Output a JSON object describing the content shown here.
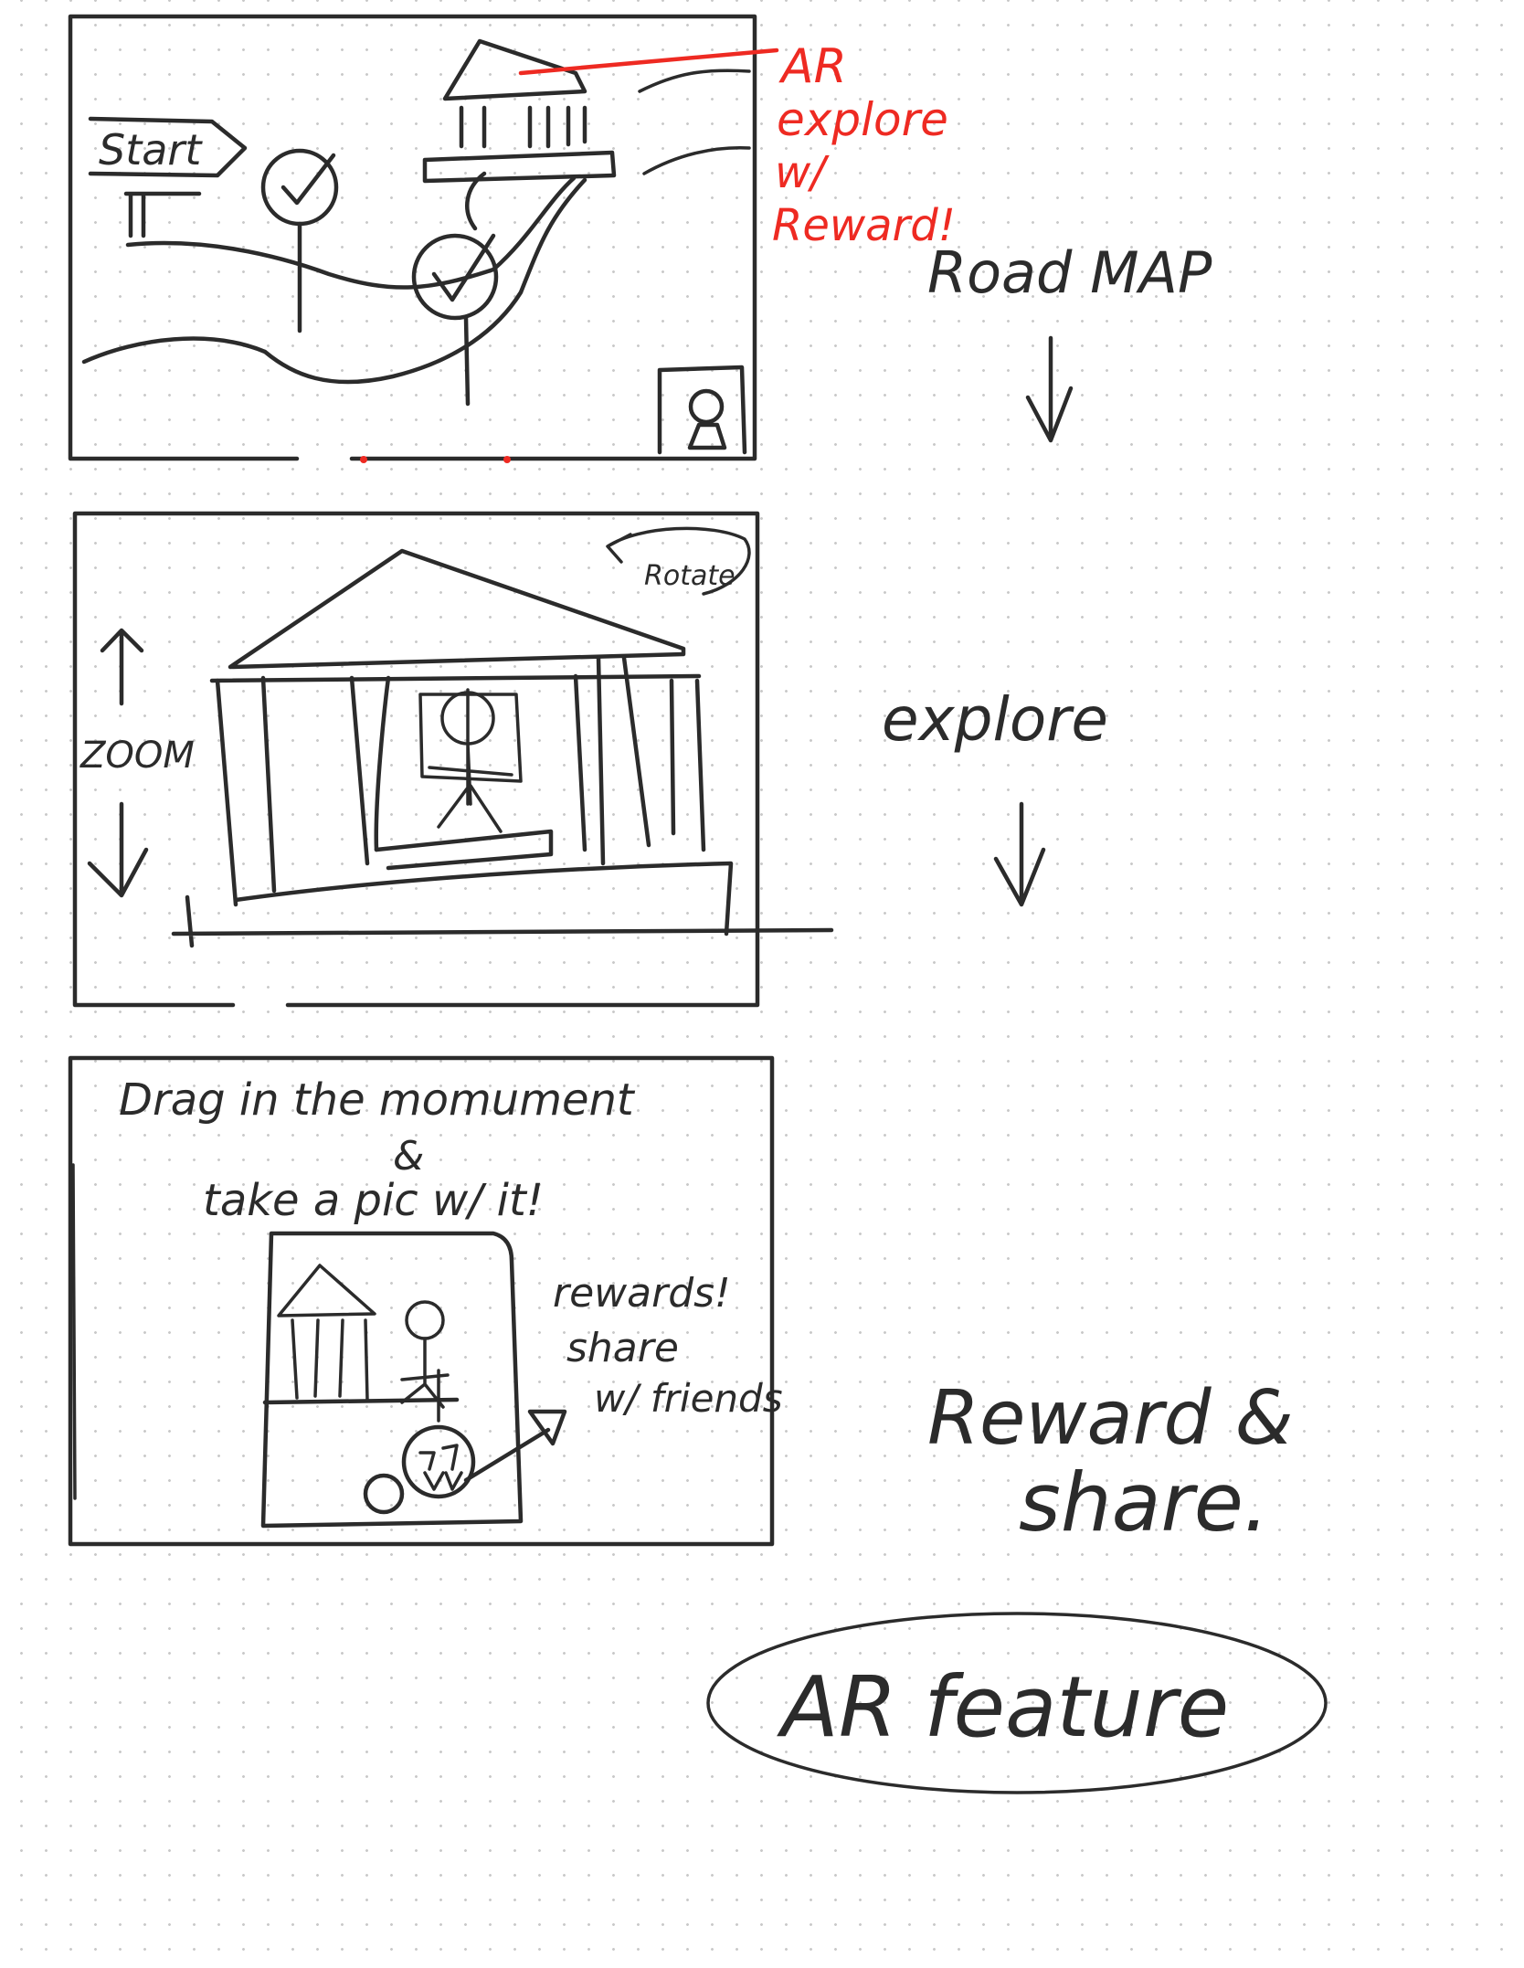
{
  "colors": {
    "ink": "#2b2b2b",
    "annotation": "#ee2a22",
    "dots": "#c9c9c9",
    "background": "#ffffff"
  },
  "frame1": {
    "start_sign": "Start",
    "annotation": [
      "AR",
      "explore",
      "w/",
      "Reward!"
    ],
    "icons": [
      "temple-icon",
      "checkmark-icon",
      "avatar-icon"
    ]
  },
  "frame2": {
    "rotate_label": "Rotate",
    "zoom_label": "ZOOM",
    "icons": [
      "temple-icon",
      "arrow-up-icon",
      "arrow-down-icon"
    ]
  },
  "frame3": {
    "line1": "Drag in the momument",
    "line2": "&",
    "line3": "take a pic w/ it!",
    "note1": "rewards!",
    "note2": "share",
    "note3": "w/ friends"
  },
  "steps": {
    "step1": "Road MAP",
    "step2": "explore",
    "step3_line1": "Reward &",
    "step3_line2": "share."
  },
  "feature_label": "AR feature"
}
